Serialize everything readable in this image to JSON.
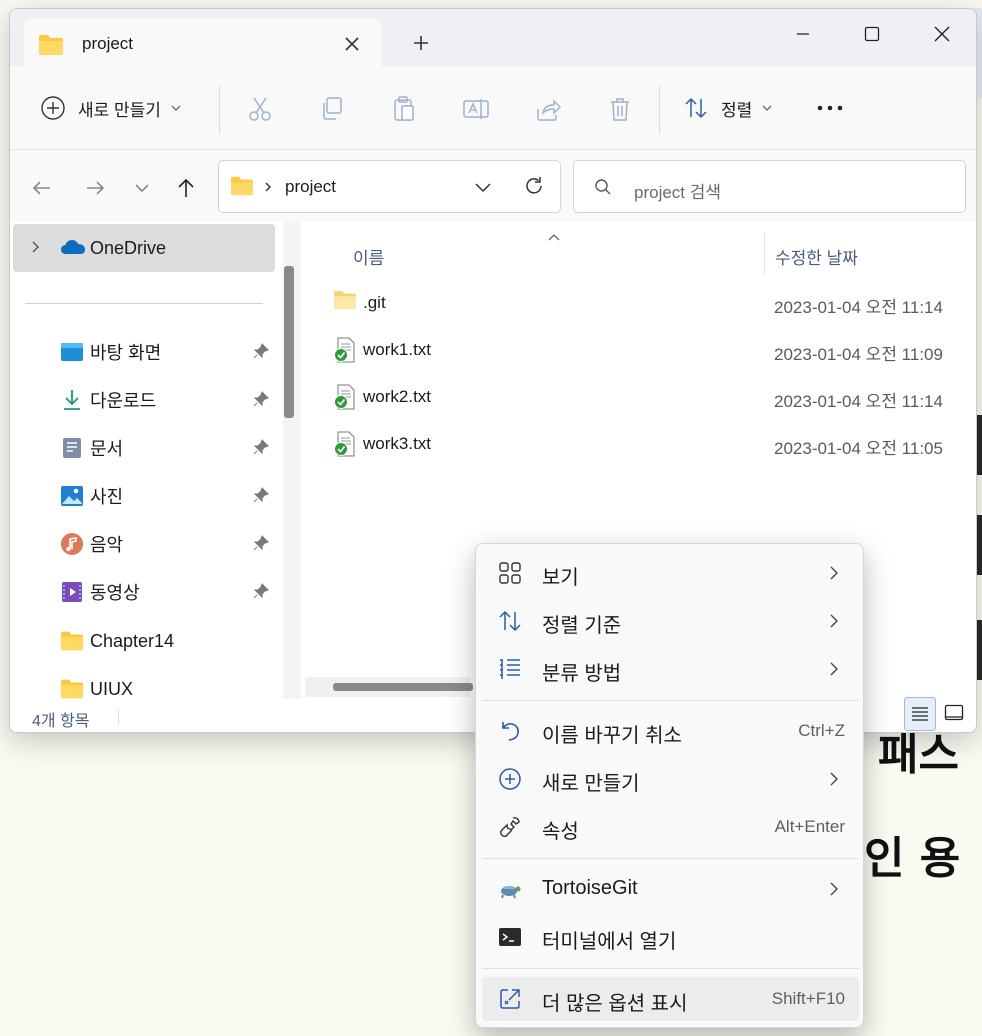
{
  "window": {
    "tab_title": "project",
    "new_tab": "+"
  },
  "toolbar": {
    "new_label": "새로 만들기",
    "sort_label": "정렬",
    "more_label": "•••"
  },
  "address": {
    "path": "project",
    "search_placeholder": "project 검색"
  },
  "navpane": {
    "onedrive": "OneDrive",
    "items": [
      {
        "label": "바탕 화면",
        "icon": "desktop-icon",
        "pinned": true
      },
      {
        "label": "다운로드",
        "icon": "download-icon",
        "pinned": true
      },
      {
        "label": "문서",
        "icon": "documents-icon",
        "pinned": true
      },
      {
        "label": "사진",
        "icon": "pictures-icon",
        "pinned": true
      },
      {
        "label": "음악",
        "icon": "music-icon",
        "pinned": true
      },
      {
        "label": "동영상",
        "icon": "videos-icon",
        "pinned": true
      },
      {
        "label": "Chapter14",
        "icon": "folder-icon",
        "pinned": false
      },
      {
        "label": "UIUX",
        "icon": "folder-icon",
        "pinned": false
      }
    ]
  },
  "files": {
    "col_name": "이름",
    "col_date": "수정한 날짜",
    "rows": [
      {
        "name": ".git",
        "date": "2023-01-04 오전 11:14",
        "icon": "folder-icon"
      },
      {
        "name": "work1.txt",
        "date": "2023-01-04 오전 11:09",
        "icon": "git-synced-file-icon"
      },
      {
        "name": "work2.txt",
        "date": "2023-01-04 오전 11:14",
        "icon": "git-synced-file-icon"
      },
      {
        "name": "work3.txt",
        "date": "2023-01-04 오전 11:05",
        "icon": "git-synced-file-icon"
      }
    ]
  },
  "status": {
    "count": "4개 항목"
  },
  "context_menu": {
    "items": [
      {
        "label": "보기",
        "shortcut": "",
        "submenu": true,
        "icon": "grid-icon"
      },
      {
        "label": "정렬 기준",
        "shortcut": "",
        "submenu": true,
        "icon": "sort-icon"
      },
      {
        "label": "분류 방법",
        "shortcut": "",
        "submenu": true,
        "icon": "group-icon"
      },
      {
        "label": "이름 바꾸기 취소",
        "shortcut": "Ctrl+Z",
        "submenu": false,
        "icon": "undo-icon"
      },
      {
        "label": "새로 만들기",
        "shortcut": "",
        "submenu": true,
        "icon": "add-circle-icon"
      },
      {
        "label": "속성",
        "shortcut": "Alt+Enter",
        "submenu": false,
        "icon": "wrench-icon"
      },
      {
        "label": "TortoiseGit",
        "shortcut": "",
        "submenu": true,
        "icon": "tortoisegit-icon"
      },
      {
        "label": "터미널에서 열기",
        "shortcut": "",
        "submenu": false,
        "icon": "terminal-icon"
      },
      {
        "label": "더 많은 옵션 표시",
        "shortcut": "Shift+F10",
        "submenu": false,
        "icon": "open-external-icon"
      }
    ]
  },
  "background": {
    "text1": "패스",
    "text2": "인 용"
  },
  "colors": {
    "accent": "#0067c0",
    "folder": "#ffc83d",
    "git_ok": "#2e9b3a"
  }
}
